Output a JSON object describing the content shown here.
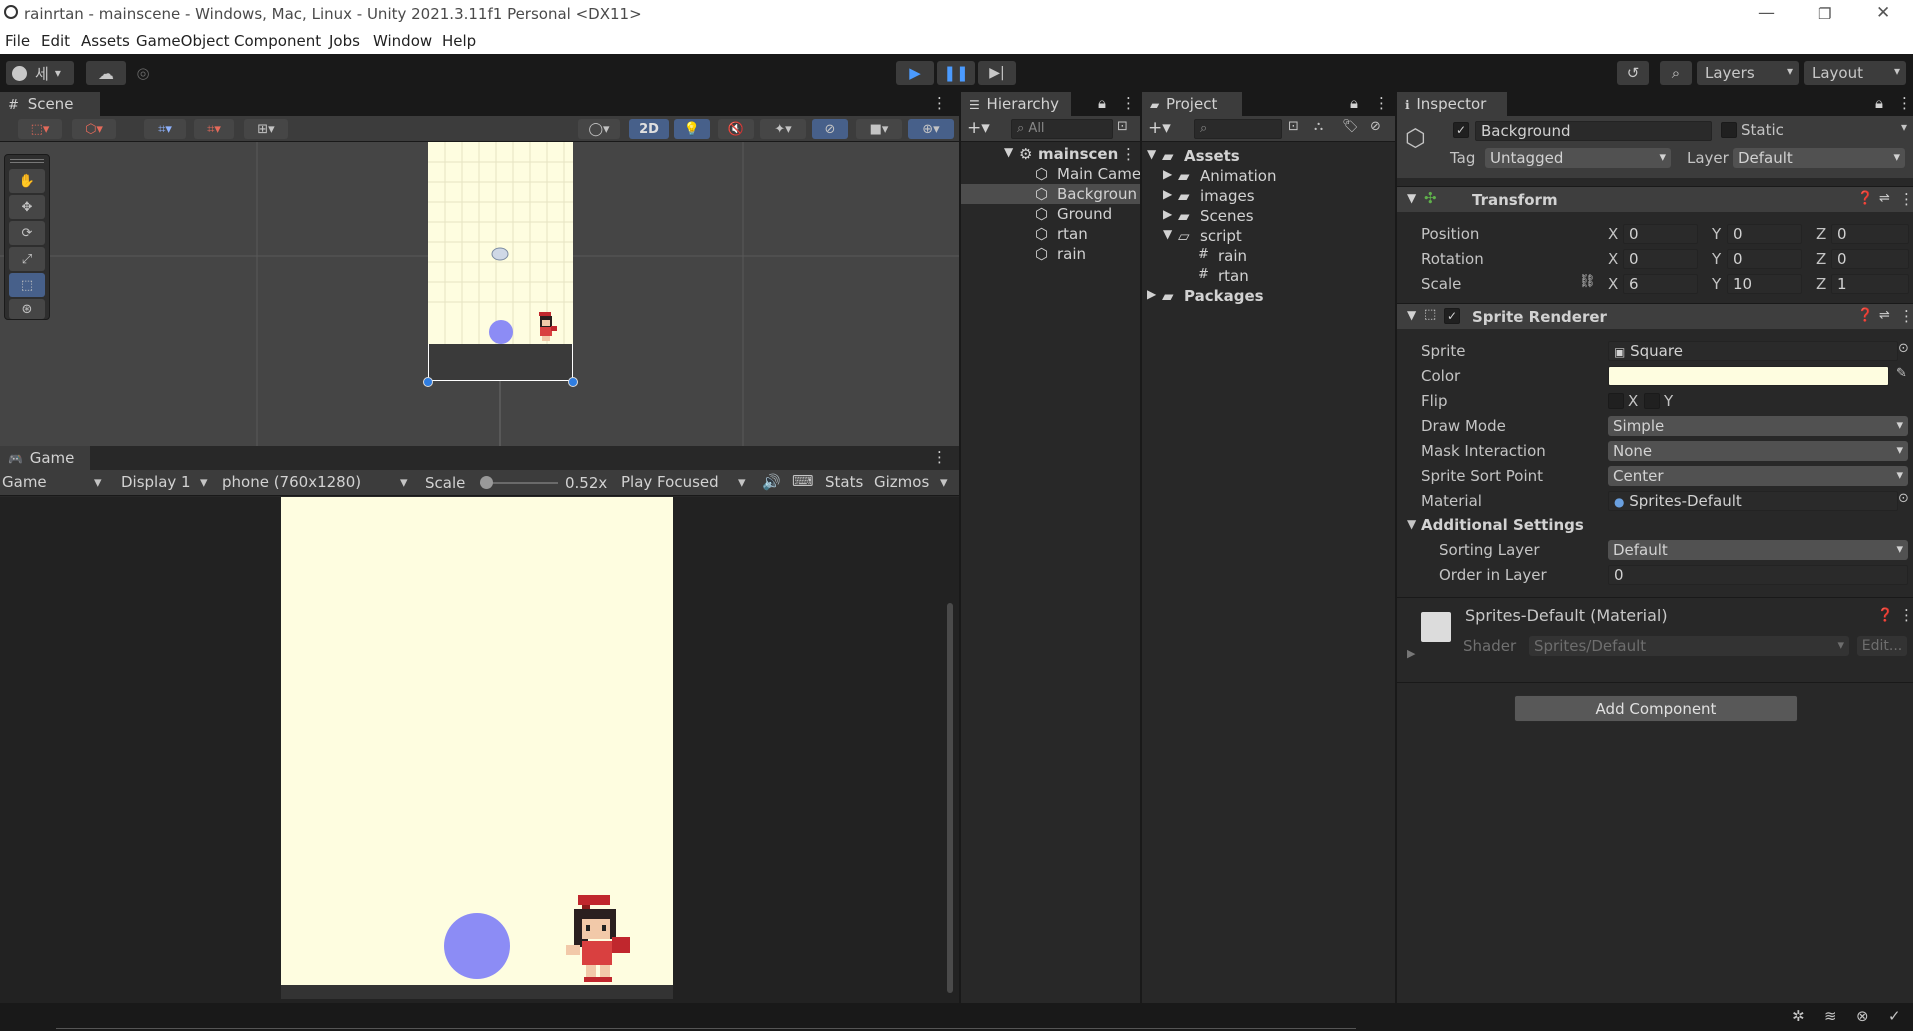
{
  "window": {
    "title": "rainrtan - mainscene - Windows, Mac, Linux - Unity 2021.3.11f1 Personal <DX11>"
  },
  "menu": [
    "File",
    "Edit",
    "Assets",
    "GameObject",
    "Component",
    "Jobs",
    "Window",
    "Help"
  ],
  "toolbar": {
    "account": "세",
    "layers": "Layers",
    "layout": "Layout"
  },
  "scene": {
    "tab": "Scene",
    "mode_2d": "2D"
  },
  "game": {
    "tab": "Game",
    "view": "Game",
    "display": "Display 1",
    "resolution": "phone (760x1280)",
    "scale_label": "Scale",
    "scale_value": "0.52x",
    "play_mode": "Play Focused",
    "stats": "Stats",
    "gizmos": "Gizmos"
  },
  "hierarchy": {
    "tab": "Hierarchy",
    "search_placeholder": "All",
    "scene": "mainscen",
    "items": [
      "Main Came",
      "Backgroun",
      "Ground",
      "rtan",
      "rain"
    ]
  },
  "project": {
    "tab": "Project",
    "root": "Assets",
    "folders": [
      "Animation",
      "images",
      "Scenes",
      "script"
    ],
    "scripts": [
      "rain",
      "rtan"
    ],
    "packages": "Packages"
  },
  "inspector": {
    "tab": "Inspector",
    "object_name": "Background",
    "static_label": "Static",
    "tag_label": "Tag",
    "tag_value": "Untagged",
    "layer_label": "Layer",
    "layer_value": "Default",
    "transform": {
      "title": "Transform",
      "position_label": "Position",
      "position": [
        "0",
        "0",
        "0"
      ],
      "rotation_label": "Rotation",
      "rotation": [
        "0",
        "0",
        "0"
      ],
      "scale_label": "Scale",
      "scale": [
        "6",
        "10",
        "1"
      ]
    },
    "axes": [
      "X",
      "Y",
      "Z"
    ],
    "sprite_renderer": {
      "title": "Sprite Renderer",
      "sprite_label": "Sprite",
      "sprite_value": "Square",
      "color_label": "Color",
      "color_value": "#fefde0",
      "flip_label": "Flip",
      "flip_x": "X",
      "flip_y": "Y",
      "draw_mode_label": "Draw Mode",
      "draw_mode_value": "Simple",
      "mask_label": "Mask Interaction",
      "mask_value": "None",
      "sort_point_label": "Sprite Sort Point",
      "sort_point_value": "Center",
      "material_label": "Material",
      "material_value": "Sprites-Default",
      "additional_label": "Additional Settings",
      "sorting_layer_label": "Sorting Layer",
      "sorting_layer_value": "Default",
      "order_label": "Order in Layer",
      "order_value": "0"
    },
    "material": {
      "title": "Sprites-Default (Material)",
      "shader_label": "Shader",
      "shader_value": "Sprites/Default",
      "edit_label": "Edit..."
    },
    "add_component": "Add Component"
  },
  "colors": {
    "background_sprite": "#fefde0",
    "rain_ball": "#8c8cf5",
    "ground": "#3a3a3a",
    "accent_blue": "#3a79bb"
  }
}
